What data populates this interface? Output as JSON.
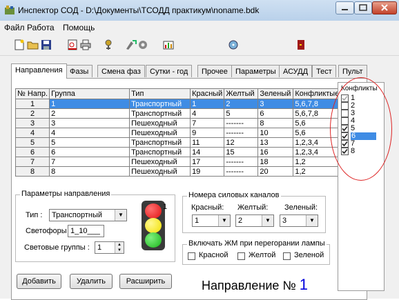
{
  "window": {
    "title": "Инспектор СОД - D:\\Документы\\ТСОДД практикум\\noname.bdk"
  },
  "menu": [
    "Файл",
    "Работа",
    "Помощь"
  ],
  "toolbar_icons": [
    "new-icon",
    "open-icon",
    "save-icon",
    "preview-icon",
    "print-icon",
    "tools-icon",
    "settings-icon",
    "gear-icon",
    "chart-icon",
    "disk-icon",
    "exit-icon"
  ],
  "tabs": [
    "Направления",
    "Фазы",
    "Смена фаз",
    "Сутки - год",
    "Прочее",
    "Параметры",
    "АСУДД",
    "Тест",
    "Пульт"
  ],
  "grid": {
    "headers": [
      "№ Напр.",
      "Группа",
      "Тип",
      "Красный",
      "Желтый",
      "Зеленый",
      "Конфликтые"
    ],
    "rows": [
      [
        "1",
        "1",
        "Транспортный",
        "1",
        "2",
        "3",
        "5,6,7,8"
      ],
      [
        "2",
        "2",
        "Транспортный",
        "4",
        "5",
        "6",
        "5,6,7,8"
      ],
      [
        "3",
        "3",
        "Пешеходный",
        "7",
        "-------",
        "8",
        "5,6"
      ],
      [
        "4",
        "4",
        "Пешеходный",
        "9",
        "-------",
        "10",
        "5,6"
      ],
      [
        "5",
        "5",
        "Транспортный",
        "11",
        "12",
        "13",
        "1,2,3,4"
      ],
      [
        "6",
        "6",
        "Транспортный",
        "14",
        "15",
        "16",
        "1,2,3,4"
      ],
      [
        "7",
        "7",
        "Пешеходный",
        "17",
        "-------",
        "18",
        "1,2"
      ],
      [
        "8",
        "8",
        "Пешеходный",
        "19",
        "-------",
        "20",
        "1,2"
      ]
    ]
  },
  "params": {
    "title": "Параметры направления",
    "type_label": "Тип :",
    "type_value": "Транспортный",
    "lights_label": "Светофоры :",
    "lights_value": "1_10___",
    "groups_label": "Световые группы :",
    "groups_value": "1",
    "signal_number": "1"
  },
  "channels": {
    "title": "Номера силовых каналов",
    "red_label": "Красный:",
    "yellow_label": "Желтый:",
    "green_label": "Зеленый:",
    "red_value": "1",
    "yellow_value": "2",
    "green_value": "3"
  },
  "lamp_burn": {
    "title": "Включать ЖМ при перегорании лампы",
    "red": "Красной",
    "yellow": "Желтой",
    "green": "Зеленой"
  },
  "buttons": {
    "add": "Добавить",
    "delete": "Удалить",
    "expand": "Расширить"
  },
  "direction": {
    "label": "Направление №",
    "number": "1"
  },
  "conflicts": {
    "title": "Конфликты",
    "items": [
      {
        "label": "1",
        "checked": true,
        "disabled": true
      },
      {
        "label": "2",
        "checked": false
      },
      {
        "label": "3",
        "checked": false
      },
      {
        "label": "4",
        "checked": false
      },
      {
        "label": "5",
        "checked": true
      },
      {
        "label": "6",
        "checked": true,
        "selected": true
      },
      {
        "label": "7",
        "checked": true
      },
      {
        "label": "8",
        "checked": true
      }
    ]
  },
  "colors": {
    "selection": "#3f8ce4",
    "red_lamp": "#e01010",
    "yellow_lamp": "#f2e000",
    "green_lamp": "#18b418",
    "annotation": "#dd2222"
  }
}
